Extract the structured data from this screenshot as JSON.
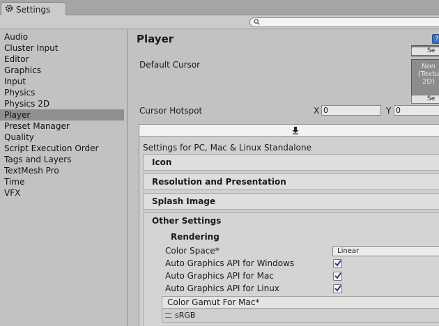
{
  "window": {
    "tab_label": "Settings",
    "search": {
      "value": "",
      "placeholder": ""
    }
  },
  "sidebar": {
    "items": [
      {
        "label": "Audio"
      },
      {
        "label": "Cluster Input"
      },
      {
        "label": "Editor"
      },
      {
        "label": "Graphics"
      },
      {
        "label": "Input"
      },
      {
        "label": "Physics"
      },
      {
        "label": "Physics 2D"
      },
      {
        "label": "Player",
        "active": true
      },
      {
        "label": "Preset Manager"
      },
      {
        "label": "Quality"
      },
      {
        "label": "Script Execution Order"
      },
      {
        "label": "Tags and Layers"
      },
      {
        "label": "TextMesh Pro"
      },
      {
        "label": "Time"
      },
      {
        "label": "VFX"
      }
    ]
  },
  "player": {
    "title": "Player",
    "select_label": "Se",
    "default_cursor": {
      "label": "Default Cursor",
      "preview_lines": [
        "Non",
        "(Textu",
        "2D)"
      ]
    },
    "cursor_hotspot": {
      "label": "Cursor Hotspot",
      "x_label": "X",
      "x_value": "0",
      "y_label": "Y",
      "y_value": "0"
    },
    "platform_title": "Settings for PC, Mac & Linux Standalone",
    "sections": {
      "icon": "Icon",
      "resolution": "Resolution and Presentation",
      "splash": "Splash Image",
      "other": "Other Settings"
    },
    "rendering": {
      "header": "Rendering",
      "color_space_label": "Color Space*",
      "color_space_value": "Linear",
      "auto_api_windows": {
        "label": "Auto Graphics API  for Windows",
        "checked": true
      },
      "auto_api_mac": {
        "label": "Auto Graphics API  for Mac",
        "checked": true
      },
      "auto_api_linux": {
        "label": "Auto Graphics API  for Linux",
        "checked": true
      },
      "color_gamut_header": "Color Gamut For Mac*",
      "color_gamut_items": [
        "sRGB"
      ]
    }
  }
}
